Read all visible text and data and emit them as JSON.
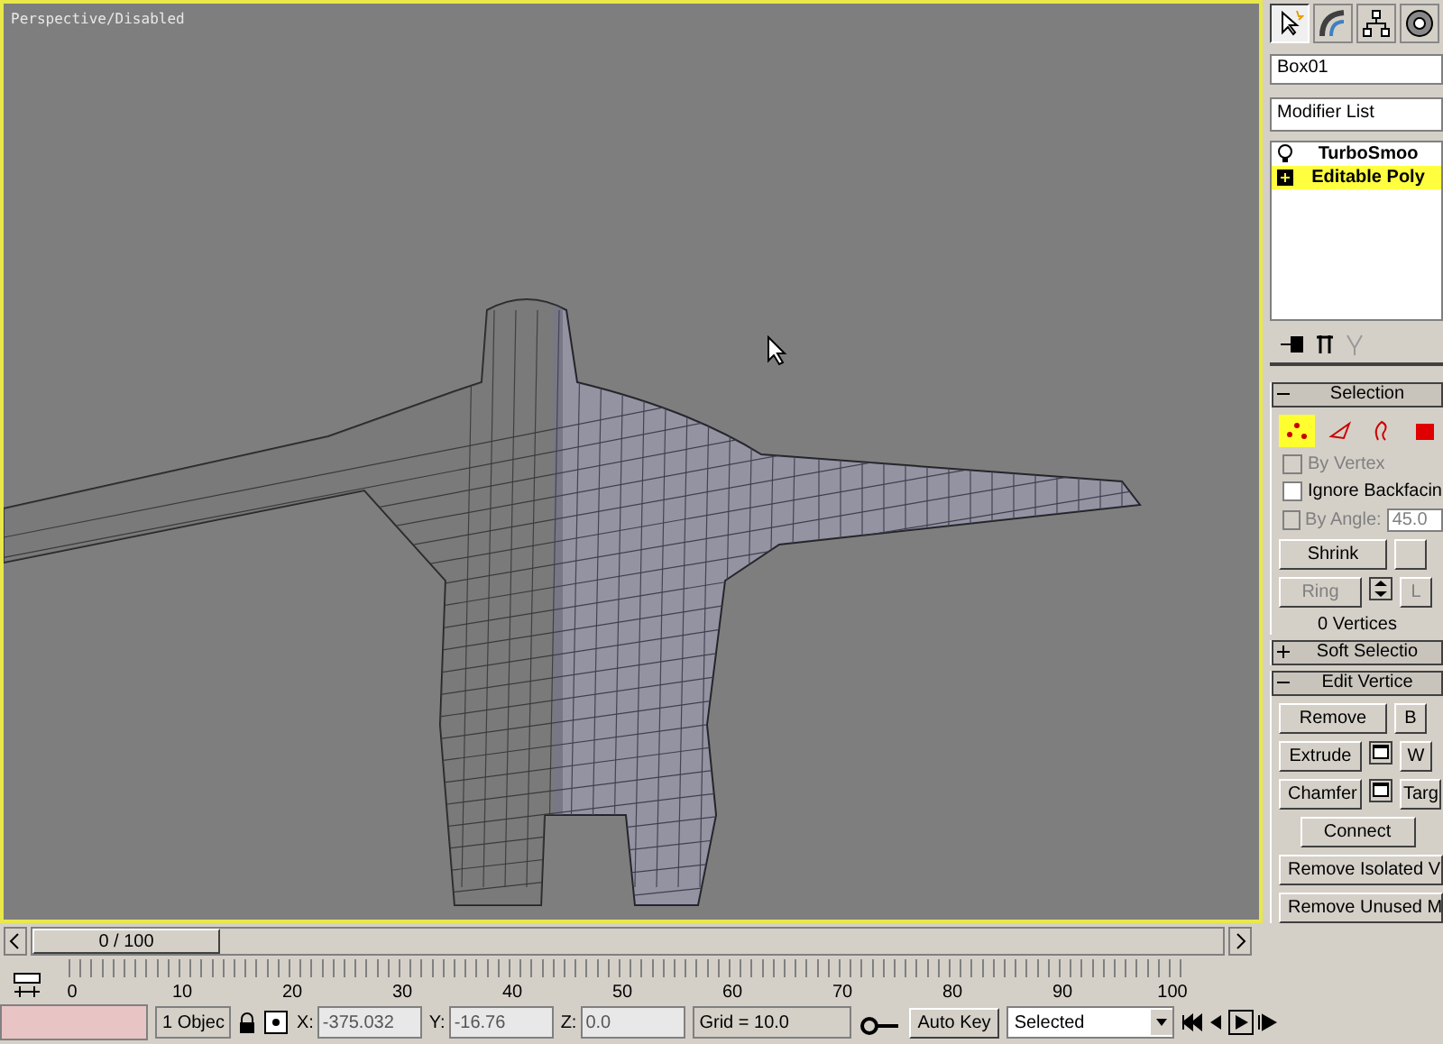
{
  "viewport": {
    "label": "Perspective/Disabled"
  },
  "command_tabs": [
    {
      "kind": "create",
      "selected": true
    },
    {
      "kind": "modify",
      "selected": false
    },
    {
      "kind": "hierarchy",
      "selected": false
    },
    {
      "kind": "motion",
      "selected": false
    }
  ],
  "object_name": "Box01",
  "modifier_list": "Modifier List",
  "modifier_stack": [
    {
      "label": "TurboSmoo",
      "kind": "bulb",
      "selected": false
    },
    {
      "label": "Editable Poly",
      "kind": "plus",
      "selected": true
    }
  ],
  "rollouts": [
    {
      "title": "Selection",
      "expanded": true,
      "subobjects": [
        {
          "kind": "vertex",
          "selected": true
        },
        {
          "kind": "edge",
          "selected": false
        },
        {
          "kind": "border",
          "selected": false
        },
        {
          "kind": "polygon",
          "selected": false
        }
      ],
      "options": [
        {
          "label": "By Vertex",
          "checked": false,
          "disabled": true
        },
        {
          "label": "Ignore Backfacin",
          "checked": false,
          "disabled": false
        },
        {
          "label": "By Angle:",
          "checked": false,
          "disabled": true,
          "value": "45.0"
        }
      ],
      "button_rows": [
        [
          {
            "label": "Shrink",
            "disabled": false
          },
          {
            "disabled": false
          }
        ],
        [
          {
            "label": "Ring",
            "disabled": true,
            "spinner": true
          },
          {
            "label": "L",
            "disabled": true
          }
        ]
      ],
      "status": "0 Vertices"
    },
    {
      "title": "Soft Selectio",
      "expanded": false
    },
    {
      "title": "Edit Vertice",
      "expanded": true,
      "button_rows": [
        [
          {
            "label": "Remove",
            "disabled": false
          },
          {
            "label": "B",
            "disabled": false
          }
        ],
        [
          {
            "label": "Extrude",
            "disabled": false,
            "settings": true
          },
          {
            "label": "W",
            "disabled": false
          }
        ],
        [
          {
            "label": "Chamfer",
            "disabled": false,
            "settings": true
          },
          {
            "label": "Targ",
            "disabled": false
          }
        ],
        [
          {
            "label": "Connect",
            "disabled": false,
            "centered": true
          }
        ],
        [
          {
            "label": "Remove Isolated V",
            "disabled": false
          }
        ],
        [
          {
            "label": "Remove Unused M",
            "disabled": false
          }
        ]
      ]
    }
  ],
  "time_slider": {
    "label": "0 / 100",
    "level": 0
  },
  "ruler": {
    "ticks": [
      "0",
      "10",
      "20",
      "30",
      "40",
      "50",
      "60",
      "70",
      "80",
      "90",
      "100"
    ]
  },
  "status_bar": {
    "selection": "1 Objec",
    "coords": [
      {
        "label": "X:",
        "value": "-375.032"
      },
      {
        "label": "Y:",
        "value": "-16.76"
      },
      {
        "label": "Z:",
        "value": "0.0"
      }
    ],
    "grid": "Grid = 10.0",
    "auto_key": "Auto Key",
    "key_filter": "Selected"
  }
}
